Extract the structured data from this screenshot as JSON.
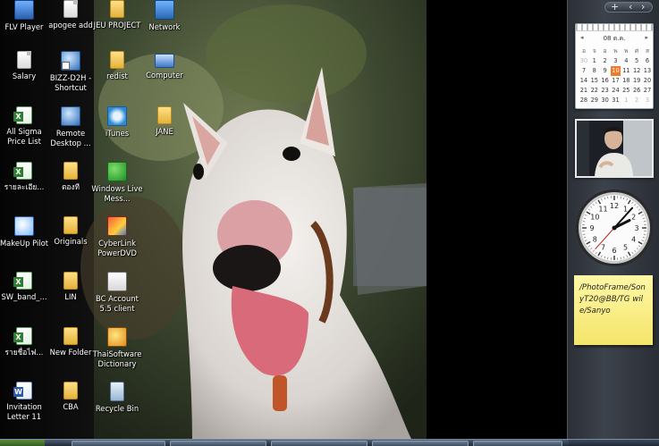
{
  "desktop": {
    "icons": [
      {
        "label": "FLV Player",
        "icon": "flv-player-icon"
      },
      {
        "label": "apogee add",
        "icon": "document-icon"
      },
      {
        "label": "JEU PROJECT",
        "icon": "folder-icon"
      },
      {
        "label": "Network",
        "icon": "network-icon"
      },
      {
        "label": "Salary",
        "icon": "document-icon"
      },
      {
        "label": "BIZZ-D2H - Shortcut",
        "icon": "shortcut-icon"
      },
      {
        "label": "redist",
        "icon": "folder-icon"
      },
      {
        "label": "Computer",
        "icon": "computer-icon"
      },
      {
        "label": "All Sigma Price List",
        "icon": "excel-icon"
      },
      {
        "label": "Remote Desktop ...",
        "icon": "remote-desktop-icon"
      },
      {
        "label": "iTunes",
        "icon": "itunes-icon"
      },
      {
        "label": "JANE",
        "icon": "folder-icon"
      },
      {
        "label": "รายละเอีย...",
        "icon": "excel-icon"
      },
      {
        "label": "ตองที",
        "icon": "folder-icon"
      },
      {
        "label": "Windows Live Mess...",
        "icon": "messenger-icon"
      },
      {
        "label": "MakeUp Pilot",
        "icon": "makeup-pilot-icon"
      },
      {
        "label": "Originals",
        "icon": "folder-icon"
      },
      {
        "label": "CyberLink PowerDVD",
        "icon": "powerdvd-icon"
      },
      {
        "label": "SW_band_...",
        "icon": "excel-icon"
      },
      {
        "label": "LIN",
        "icon": "folder-icon"
      },
      {
        "label": "BC Account 5.5 client",
        "icon": "bc-account-icon"
      },
      {
        "label": "รายชื่อไฟ...",
        "icon": "excel-icon"
      },
      {
        "label": "New Folder",
        "icon": "folder-icon"
      },
      {
        "label": "ThaiSoftware Dictionary",
        "icon": "dictionary-icon"
      },
      {
        "label": "Invitation Letter 11",
        "icon": "word-icon"
      },
      {
        "label": "CBA",
        "icon": "folder-icon"
      },
      {
        "label": "Recycle Bin",
        "icon": "recycle-bin-icon"
      }
    ]
  },
  "sidebar": {
    "top_controls": {
      "add": "+",
      "prev": "‹",
      "next": "›"
    },
    "calendar": {
      "month": "08 ต.ค.",
      "prev_arrow": "◂",
      "next_arrow": "▸",
      "weekday_headers": [
        "อ",
        "จ",
        "อ",
        "พ",
        "พ",
        "ศ",
        "ส"
      ],
      "weeks": [
        [
          "30",
          "1",
          "2",
          "3",
          "4",
          "5",
          "6"
        ],
        [
          "7",
          "8",
          "9",
          "10",
          "11",
          "12",
          "13"
        ],
        [
          "14",
          "15",
          "16",
          "17",
          "18",
          "19",
          "20"
        ],
        [
          "21",
          "22",
          "23",
          "24",
          "25",
          "26",
          "27"
        ],
        [
          "28",
          "29",
          "30",
          "31",
          "1",
          "2",
          "3"
        ]
      ],
      "today": "10"
    },
    "clock": {
      "hour": 2,
      "minute": 7,
      "second": 37
    },
    "note": {
      "text": "/PhotoFrame/SonyT20@BB/TG wile/Sanyo"
    }
  },
  "colors": {
    "sidebar_bg": "#3d434c",
    "note_bg": "#fff8a6",
    "today_highlight": "#f07a2a"
  }
}
